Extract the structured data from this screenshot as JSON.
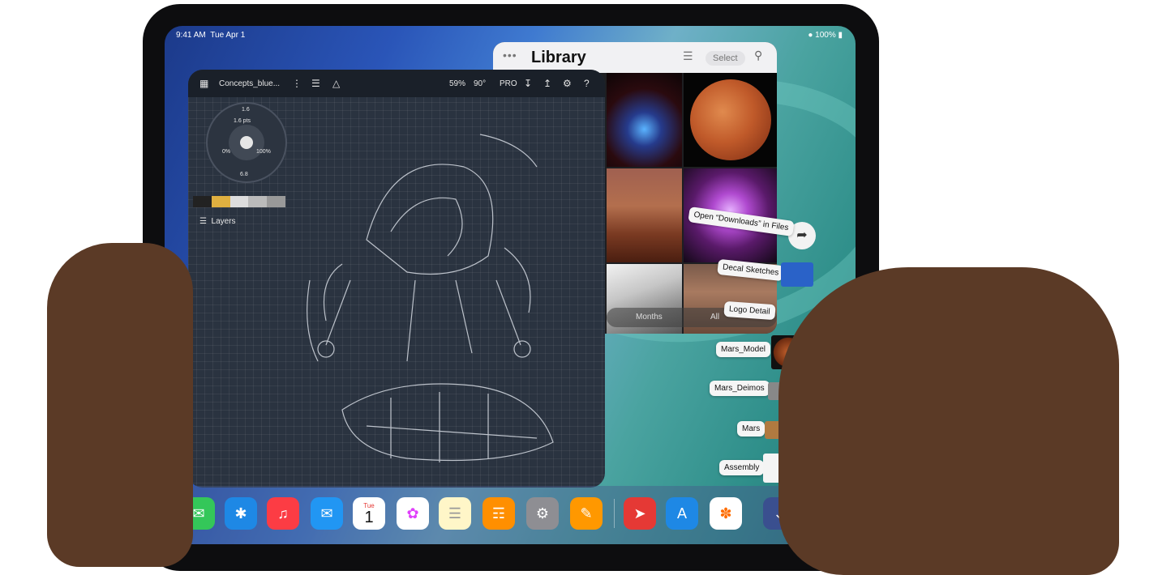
{
  "status_bar": {
    "time": "9:41 AM",
    "date": "Tue Apr 1",
    "battery": "100%"
  },
  "library": {
    "title": "Library",
    "select_label": "Select",
    "segments": [
      "Months",
      "All"
    ]
  },
  "concepts": {
    "file_name": "Concepts_blue...",
    "zoom": "59%",
    "rotation": "90°",
    "pro_label": "PRO",
    "layers_label": "Layers",
    "brush_size": "1.6",
    "brush_pts": "1.6 pts",
    "opacity_left": "0%",
    "opacity_right": "100%",
    "smoothing": "6.8"
  },
  "drag_items": [
    {
      "label": "Open “Downloads” in Files"
    },
    {
      "label": "Decal Sketches"
    },
    {
      "label": "Logo Detail"
    },
    {
      "label": "Mars_Model"
    },
    {
      "label": "Mars_Deimos"
    },
    {
      "label": "Mars"
    },
    {
      "label": "Assembly"
    }
  ],
  "dock": {
    "calendar_day": "Tue",
    "calendar_date": "1"
  }
}
